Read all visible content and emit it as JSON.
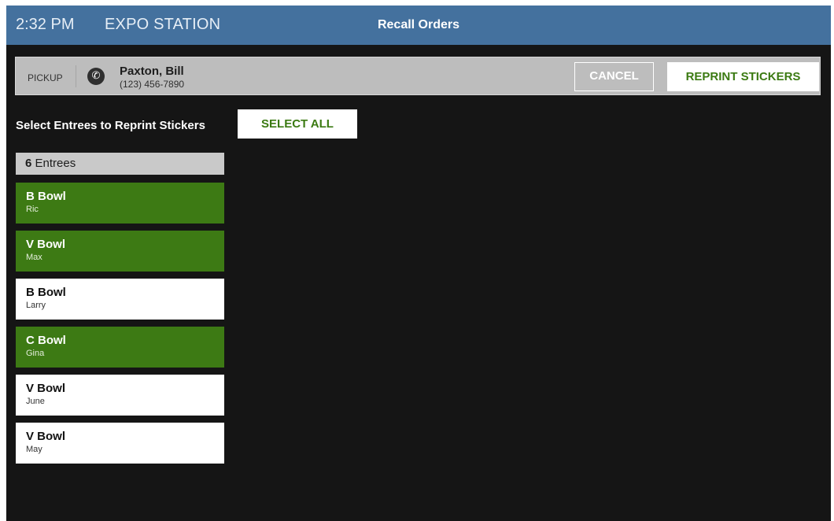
{
  "header": {
    "time": "2:32 PM",
    "station": "EXPO STATION",
    "title": "Recall Orders"
  },
  "order": {
    "type": "PICKUP",
    "icon": "phone-icon",
    "customer_name": "Paxton, Bill",
    "customer_phone": "(123) 456-7890",
    "cancel_label": "CANCEL",
    "reprint_label": "REPRINT STICKERS"
  },
  "selection": {
    "instruction": "Select Entrees to Reprint Stickers",
    "select_all_label": "SELECT ALL"
  },
  "entrees": {
    "count": "6",
    "count_label": " Entrees",
    "items": [
      {
        "name": "B Bowl",
        "guest": "Ric",
        "selected": true
      },
      {
        "name": "V Bowl",
        "guest": "Max",
        "selected": true
      },
      {
        "name": "B Bowl",
        "guest": "Larry",
        "selected": false
      },
      {
        "name": "C Bowl",
        "guest": "Gina",
        "selected": true
      },
      {
        "name": "V Bowl",
        "guest": "June",
        "selected": false
      },
      {
        "name": "V Bowl",
        "guest": "May",
        "selected": false
      }
    ]
  },
  "colors": {
    "header_bg": "#44719e",
    "background": "#151515",
    "selected_green": "#3d7a14",
    "accent_text_green": "#3b7a12"
  }
}
